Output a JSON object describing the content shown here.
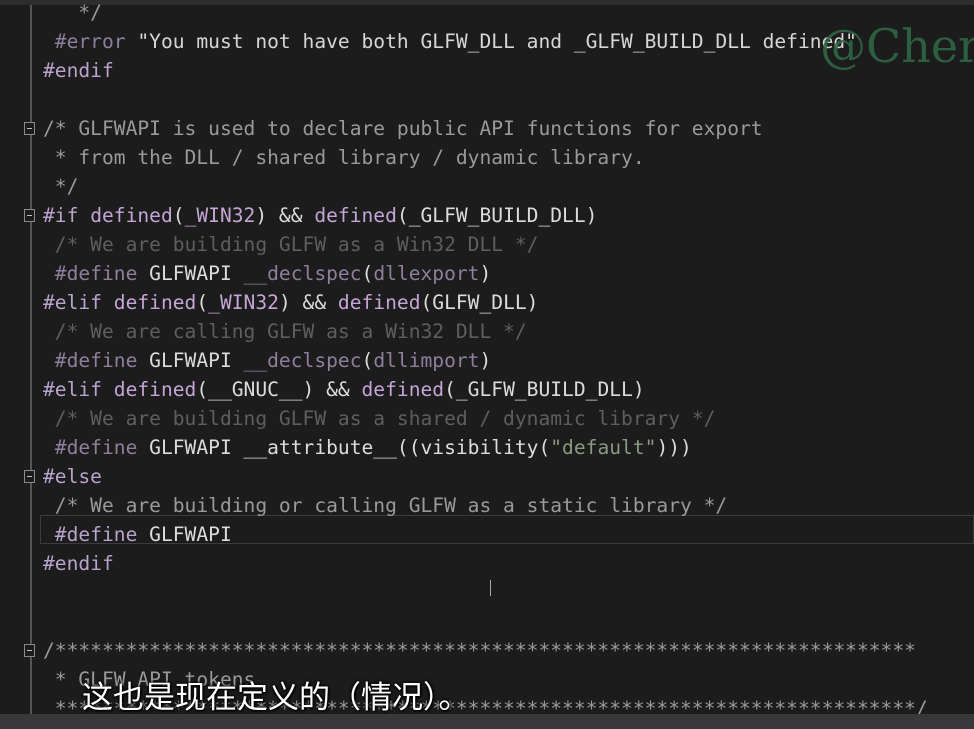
{
  "watermark": "@Chern",
  "subtitle": "这也是现在定义的（情况）。",
  "code_lines": [
    [
      {
        "t": "   */",
        "c": "cm"
      }
    ],
    [
      {
        "t": " #error",
        "c": "dim"
      },
      {
        "t": " \"You must not have both GLFW_DLL and _GLFW_BUILD_DLL defined\"",
        "c": "str"
      }
    ],
    [
      {
        "t": "#endif",
        "c": "pp"
      }
    ],
    [],
    [
      {
        "t": "/* GLFWAPI is used to declare public API functions for export",
        "c": "cm"
      }
    ],
    [
      {
        "t": " * from the DLL / shared library / dynamic library.",
        "c": "cm"
      }
    ],
    [
      {
        "t": " */",
        "c": "cm"
      }
    ],
    [
      {
        "t": "#if ",
        "c": "pp"
      },
      {
        "t": "defined",
        "c": "kw"
      },
      {
        "t": "(",
        "c": "id"
      },
      {
        "t": "_WIN32",
        "c": "kw"
      },
      {
        "t": ") && ",
        "c": "id"
      },
      {
        "t": "defined",
        "c": "kw"
      },
      {
        "t": "(_GLFW_BUILD_DLL)",
        "c": "id"
      }
    ],
    [
      {
        "t": " /* We are building GLFW as a Win32 DLL */",
        "c": "cmd"
      }
    ],
    [
      {
        "t": " #define",
        "c": "dim"
      },
      {
        "t": " GLFWAPI ",
        "c": "id"
      },
      {
        "t": "__declspec",
        "c": "dim"
      },
      {
        "t": "(",
        "c": "id"
      },
      {
        "t": "dllexport",
        "c": "dim"
      },
      {
        "t": ")",
        "c": "id"
      }
    ],
    [
      {
        "t": "#elif ",
        "c": "pp"
      },
      {
        "t": "defined",
        "c": "kw"
      },
      {
        "t": "(",
        "c": "id"
      },
      {
        "t": "_WIN32",
        "c": "kw"
      },
      {
        "t": ") && ",
        "c": "id"
      },
      {
        "t": "defined",
        "c": "kw"
      },
      {
        "t": "(GLFW_DLL)",
        "c": "id"
      }
    ],
    [
      {
        "t": " /* We are calling GLFW as a Win32 DLL */",
        "c": "cmd"
      }
    ],
    [
      {
        "t": " #define",
        "c": "dim"
      },
      {
        "t": " GLFWAPI ",
        "c": "id"
      },
      {
        "t": "__declspec",
        "c": "dim"
      },
      {
        "t": "(",
        "c": "id"
      },
      {
        "t": "dllimport",
        "c": "dim"
      },
      {
        "t": ")",
        "c": "id"
      }
    ],
    [
      {
        "t": "#elif ",
        "c": "pp"
      },
      {
        "t": "defined",
        "c": "kw"
      },
      {
        "t": "(__GNUC__) && ",
        "c": "id"
      },
      {
        "t": "defined",
        "c": "kw"
      },
      {
        "t": "(_GLFW_BUILD_DLL)",
        "c": "id"
      }
    ],
    [
      {
        "t": " /* We are building GLFW as a shared / dynamic library */",
        "c": "cmd"
      }
    ],
    [
      {
        "t": " #define",
        "c": "dim"
      },
      {
        "t": " GLFWAPI __attribute__((visibility(",
        "c": "id"
      },
      {
        "t": "\"default\"",
        "c": "strd"
      },
      {
        "t": ")))",
        "c": "id"
      }
    ],
    [
      {
        "t": "#else",
        "c": "pp"
      }
    ],
    [
      {
        "t": " /* We are building or calling GLFW as a static library */",
        "c": "cm"
      }
    ],
    [
      {
        "t": " #define",
        "c": "pp"
      },
      {
        "t": " GLFWAPI",
        "c": "id"
      }
    ],
    [
      {
        "t": "#endif",
        "c": "pp"
      }
    ],
    [],
    [],
    [
      {
        "t": "/*************************************************************************",
        "c": "cm"
      }
    ],
    [
      {
        "t": " * GLFW API tokens",
        "c": "cm"
      }
    ],
    [
      {
        "t": " *************************************************************************/",
        "c": "cm"
      }
    ]
  ],
  "fold_lines": [
    4,
    7,
    16,
    22
  ],
  "colors": {
    "background": "#1c1c1c",
    "preprocessor": "#b9a3cc",
    "comment": "#9a9a9a",
    "inactive_comment": "#5e5e5e",
    "watermark": "#2f6b47"
  }
}
